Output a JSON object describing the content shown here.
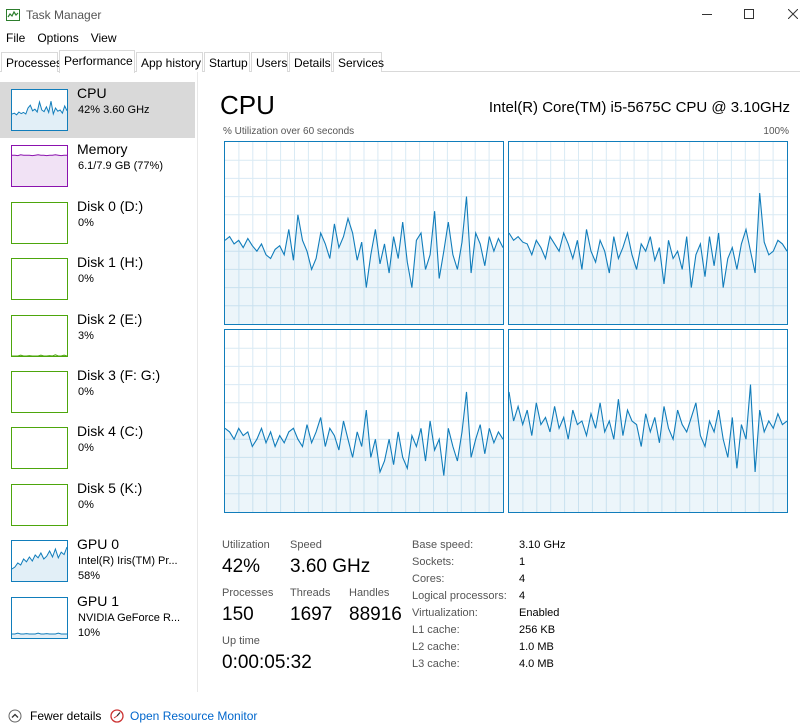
{
  "window": {
    "title": "Task Manager",
    "minimize_icon": "minimize-icon",
    "maximize_icon": "maximize-icon",
    "close_icon": "close-icon"
  },
  "menu": [
    {
      "label": "File"
    },
    {
      "label": "Options"
    },
    {
      "label": "View"
    }
  ],
  "tabs": [
    {
      "label": "Processes"
    },
    {
      "label": "Performance"
    },
    {
      "label": "App history"
    },
    {
      "label": "Startup"
    },
    {
      "label": "Users"
    },
    {
      "label": "Details"
    },
    {
      "label": "Services"
    }
  ],
  "active_tab": "Performance",
  "sidebar": {
    "items": [
      {
        "title": "CPU",
        "sub": "42%  3.60 GHz",
        "sub2": "",
        "color": "#117dbb",
        "selected": true,
        "history": [
          0.4,
          0.42,
          0.38,
          0.45,
          0.41,
          0.44,
          0.4,
          0.55,
          0.62,
          0.48,
          0.52,
          0.45,
          0.7,
          0.5,
          0.46,
          0.58,
          0.44,
          0.72,
          0.4,
          0.55,
          0.47,
          0.5,
          0.42,
          0.6,
          0.48
        ]
      },
      {
        "title": "Memory",
        "sub": "6.1/7.9 GB (77%)",
        "sub2": "",
        "color": "#8b12ae",
        "selected": false,
        "history": [
          0.77,
          0.77,
          0.76,
          0.78,
          0.77,
          0.77,
          0.77,
          0.76,
          0.77,
          0.78,
          0.77,
          0.77,
          0.76,
          0.77,
          0.77,
          0.78,
          0.77,
          0.76,
          0.77,
          0.77
        ]
      },
      {
        "title": "Disk 0 (D:)",
        "sub": "0%",
        "sub2": "",
        "color": "#4da60c",
        "selected": false,
        "history": []
      },
      {
        "title": "Disk 1 (H:)",
        "sub": "0%",
        "sub2": "",
        "color": "#4da60c",
        "selected": false,
        "history": []
      },
      {
        "title": "Disk 2 (E:)",
        "sub": "3%",
        "sub2": "",
        "color": "#4da60c",
        "selected": false,
        "history": [
          0,
          0,
          0,
          0.02,
          0,
          0,
          0.01,
          0,
          0,
          0,
          0.02,
          0,
          0,
          0.01,
          0,
          0.03,
          0,
          0,
          0.02,
          0
        ]
      },
      {
        "title": "Disk 3 (F: G:)",
        "sub": "0%",
        "sub2": "",
        "color": "#4da60c",
        "selected": false,
        "history": []
      },
      {
        "title": "Disk 4 (C:)",
        "sub": "0%",
        "sub2": "",
        "color": "#4da60c",
        "selected": false,
        "history": []
      },
      {
        "title": "Disk 5 (K:)",
        "sub": "0%",
        "sub2": "",
        "color": "#4da60c",
        "selected": false,
        "history": []
      },
      {
        "title": "GPU 0",
        "sub": "Intel(R) Iris(TM) Pr...",
        "sub2": "58%",
        "color": "#117dbb",
        "selected": false,
        "history": [
          0.3,
          0.35,
          0.45,
          0.4,
          0.55,
          0.48,
          0.6,
          0.5,
          0.65,
          0.58,
          0.7,
          0.55,
          0.62,
          0.75,
          0.6,
          0.8,
          0.58,
          0.72,
          0.66,
          0.85
        ]
      },
      {
        "title": "GPU 1",
        "sub": "NVIDIA GeForce R...",
        "sub2": "10%",
        "color": "#117dbb",
        "selected": false,
        "history": [
          0.1,
          0.1,
          0.12,
          0.1,
          0.1,
          0.11,
          0.1,
          0.1,
          0.1,
          0.12,
          0.1,
          0.1,
          0.11,
          0.1,
          0.1,
          0.1,
          0.12,
          0.1,
          0.1,
          0.1
        ]
      }
    ]
  },
  "main": {
    "title": "CPU",
    "cpu_name": "Intel(R) Core(TM) i5-5675C CPU @ 3.10GHz",
    "util_label": "% Utilization over 60 seconds",
    "util_max": "100%",
    "graph_color": "#117dbb",
    "cores": [
      {
        "history": [
          0.46,
          0.48,
          0.44,
          0.46,
          0.42,
          0.47,
          0.43,
          0.4,
          0.44,
          0.38,
          0.36,
          0.41,
          0.43,
          0.38,
          0.52,
          0.35,
          0.6,
          0.46,
          0.4,
          0.3,
          0.36,
          0.5,
          0.44,
          0.36,
          0.55,
          0.42,
          0.48,
          0.58,
          0.5,
          0.35,
          0.45,
          0.2,
          0.38,
          0.52,
          0.33,
          0.44,
          0.28,
          0.48,
          0.36,
          0.56,
          0.34,
          0.2,
          0.46,
          0.5,
          0.3,
          0.38,
          0.62,
          0.25,
          0.4,
          0.56,
          0.38,
          0.3,
          0.45,
          0.7,
          0.28,
          0.5,
          0.44,
          0.32,
          0.48,
          0.4,
          0.47,
          0.42
        ]
      },
      {
        "history": [
          0.5,
          0.46,
          0.48,
          0.45,
          0.44,
          0.38,
          0.46,
          0.42,
          0.36,
          0.48,
          0.44,
          0.4,
          0.5,
          0.44,
          0.36,
          0.46,
          0.3,
          0.52,
          0.4,
          0.34,
          0.46,
          0.4,
          0.28,
          0.48,
          0.36,
          0.42,
          0.5,
          0.38,
          0.3,
          0.44,
          0.4,
          0.48,
          0.35,
          0.42,
          0.22,
          0.46,
          0.36,
          0.4,
          0.3,
          0.48,
          0.2,
          0.38,
          0.44,
          0.26,
          0.48,
          0.32,
          0.5,
          0.2,
          0.36,
          0.42,
          0.3,
          0.44,
          0.52,
          0.4,
          0.28,
          0.72,
          0.45,
          0.38,
          0.4,
          0.46,
          0.44,
          0.4
        ]
      },
      {
        "history": [
          0.46,
          0.44,
          0.4,
          0.46,
          0.42,
          0.44,
          0.36,
          0.4,
          0.46,
          0.38,
          0.44,
          0.36,
          0.42,
          0.38,
          0.44,
          0.46,
          0.4,
          0.36,
          0.48,
          0.38,
          0.44,
          0.52,
          0.36,
          0.46,
          0.42,
          0.34,
          0.5,
          0.4,
          0.3,
          0.44,
          0.36,
          0.56,
          0.3,
          0.4,
          0.22,
          0.28,
          0.4,
          0.26,
          0.44,
          0.3,
          0.24,
          0.42,
          0.36,
          0.46,
          0.28,
          0.5,
          0.34,
          0.4,
          0.2,
          0.46,
          0.36,
          0.28,
          0.44,
          0.66,
          0.3,
          0.4,
          0.48,
          0.32,
          0.46,
          0.38,
          0.44,
          0.4
        ]
      },
      {
        "history": [
          0.66,
          0.5,
          0.58,
          0.48,
          0.56,
          0.42,
          0.6,
          0.48,
          0.52,
          0.44,
          0.58,
          0.46,
          0.52,
          0.4,
          0.56,
          0.48,
          0.5,
          0.42,
          0.54,
          0.46,
          0.6,
          0.44,
          0.5,
          0.4,
          0.62,
          0.42,
          0.56,
          0.5,
          0.48,
          0.36,
          0.54,
          0.44,
          0.52,
          0.38,
          0.58,
          0.46,
          0.4,
          0.56,
          0.48,
          0.44,
          0.52,
          0.6,
          0.42,
          0.36,
          0.5,
          0.44,
          0.56,
          0.4,
          0.3,
          0.52,
          0.24,
          0.48,
          0.4,
          0.7,
          0.22,
          0.56,
          0.44,
          0.5,
          0.46,
          0.54,
          0.48,
          0.5
        ]
      }
    ],
    "stats": {
      "utilization_label": "Utilization",
      "utilization_value": "42%",
      "speed_label": "Speed",
      "speed_value": "3.60 GHz",
      "processes_label": "Processes",
      "processes_value": "150",
      "threads_label": "Threads",
      "threads_value": "1697",
      "handles_label": "Handles",
      "handles_value": "88916",
      "uptime_label": "Up time",
      "uptime_value": "0:00:05:32"
    },
    "properties": [
      {
        "label": "Base speed:",
        "value": "3.10 GHz"
      },
      {
        "label": "Sockets:",
        "value": "1"
      },
      {
        "label": "Cores:",
        "value": "4"
      },
      {
        "label": "Logical processors:",
        "value": "4"
      },
      {
        "label": "Virtualization:",
        "value": "Enabled"
      },
      {
        "label": "L1 cache:",
        "value": "256 KB"
      },
      {
        "label": "L2 cache:",
        "value": "1.0 MB"
      },
      {
        "label": "L3 cache:",
        "value": "4.0 MB"
      }
    ]
  },
  "footer": {
    "fewer_details": "Fewer details",
    "fewer_icon": "chevron-up-icon",
    "resource_monitor": "Open Resource Monitor",
    "resource_icon": "resource-monitor-icon",
    "link_color": "#0066cc"
  }
}
